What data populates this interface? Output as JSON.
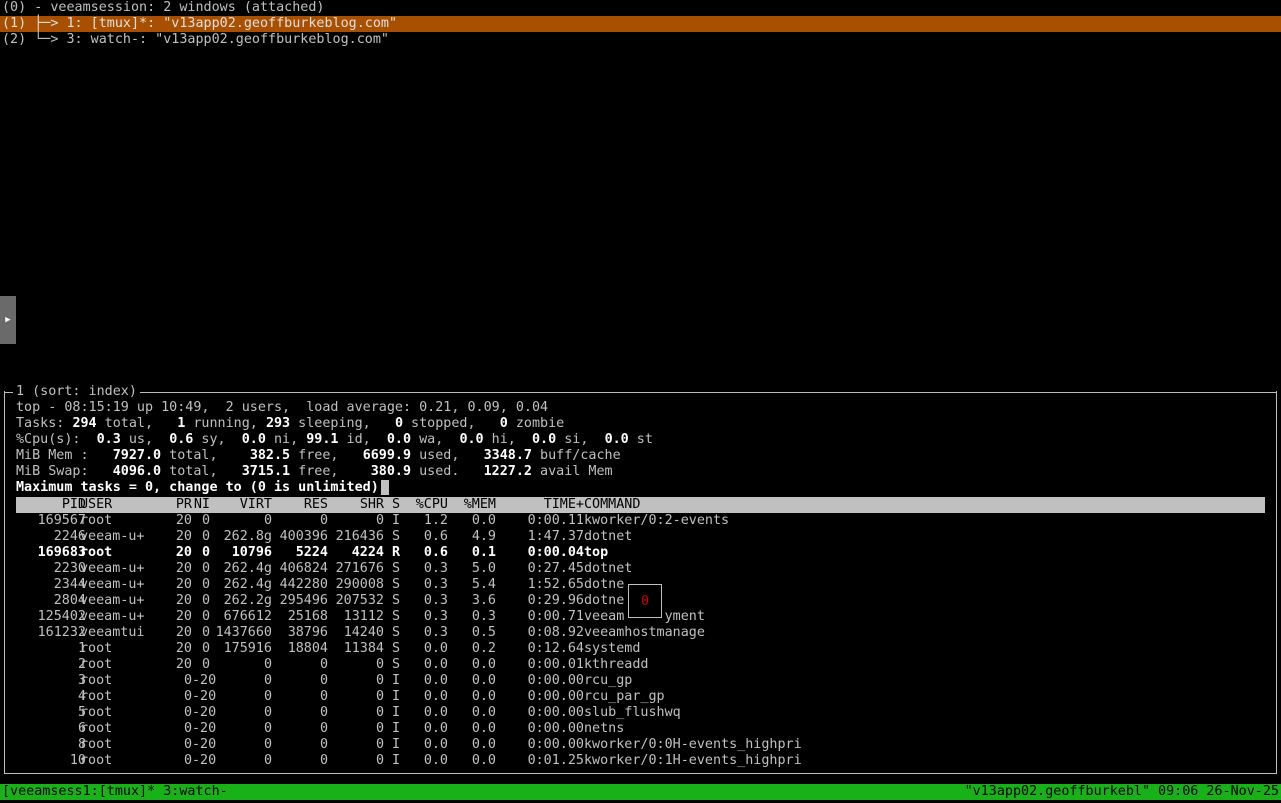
{
  "tree": {
    "header": "(0) - veeamsession: 2 windows (attached)",
    "rows": [
      {
        "text": "(1) ├─> 1: [tmux]*: \"v13app02.geoffburkeblog.com\"",
        "selected": true
      },
      {
        "text": "(2) └─> 3: watch-: \"v13app02.geoffburkeblog.com\"",
        "selected": false
      }
    ]
  },
  "side_handle_icon": "right-triangle-icon",
  "pane": {
    "title": "1 (sort: index)",
    "summary": {
      "line1": "top - 08:15:19 up 10:49,  2 users,  load average: 0.21, 0.09, 0.04",
      "tasks": {
        "label": "Tasks:",
        "total": "294",
        "total_l": " total,   ",
        "running": "1",
        "running_l": " running, ",
        "sleeping": "293",
        "sleeping_l": " sleeping,   ",
        "stopped": "0",
        "stopped_l": " stopped,   ",
        "zombie": "0",
        "zombie_l": " zombie"
      },
      "cpu": {
        "label": "%Cpu(s):  ",
        "us": "0.3",
        "us_l": " us,  ",
        "sy": "0.6",
        "sy_l": " sy,  ",
        "ni": "0.0",
        "ni_l": " ni, ",
        "id": "99.1",
        "id_l": " id,  ",
        "wa": "0.0",
        "wa_l": " wa,  ",
        "hi": "0.0",
        "hi_l": " hi,  ",
        "si": "0.0",
        "si_l": " si,  ",
        "st": "0.0",
        "st_l": " st"
      },
      "mem": {
        "label": "MiB Mem :   ",
        "total": "7927.0",
        "total_l": " total,    ",
        "free": "382.5",
        "free_l": " free,   ",
        "used": "6699.9",
        "used_l": " used,   ",
        "buff": "3348.7",
        "buff_l": " buff/cache"
      },
      "swap": {
        "label": "MiB Swap:   ",
        "total": "4096.0",
        "total_l": " total,   ",
        "free": "3715.1",
        "free_l": " free,    ",
        "used": "380.9",
        "used_l": " used.   ",
        "avail": "1227.2",
        "avail_l": " avail Mem"
      },
      "prompt": "Maximum tasks = 0, change to (0 is unlimited)"
    },
    "columns": {
      "pid": "PID",
      "user": "USER",
      "pr": "PR",
      "ni": "NI",
      "virt": "VIRT",
      "res": "RES",
      "shr": "SHR",
      "s": "S",
      "cpu": "%CPU",
      "mem": "%MEM",
      "time": "TIME+",
      "cmd": "COMMAND"
    },
    "processes": [
      {
        "pid": "169567",
        "user": "root",
        "pr": "20",
        "ni": "0",
        "virt": "0",
        "res": "0",
        "shr": "0",
        "s": "I",
        "cpu": "1.2",
        "mem": "0.0",
        "time": "0:00.11",
        "cmd": "kworker/0:2-events"
      },
      {
        "pid": "2246",
        "user": "veeam-u+",
        "pr": "20",
        "ni": "0",
        "virt": "262.8g",
        "res": "400396",
        "shr": "216436",
        "s": "S",
        "cpu": "0.6",
        "mem": "4.9",
        "time": "1:47.37",
        "cmd": "dotnet"
      },
      {
        "pid": "169683",
        "user": "root",
        "pr": "20",
        "ni": "0",
        "virt": "10796",
        "res": "5224",
        "shr": "4224",
        "s": "R",
        "cpu": "0.6",
        "mem": "0.1",
        "time": "0:00.04",
        "cmd": "top",
        "hl": true
      },
      {
        "pid": "2230",
        "user": "veeam-u+",
        "pr": "20",
        "ni": "0",
        "virt": "262.4g",
        "res": "406824",
        "shr": "271676",
        "s": "S",
        "cpu": "0.3",
        "mem": "5.0",
        "time": "0:27.45",
        "cmd": "dotnet"
      },
      {
        "pid": "2344",
        "user": "veeam-u+",
        "pr": "20",
        "ni": "0",
        "virt": "262.4g",
        "res": "442280",
        "shr": "290008",
        "s": "S",
        "cpu": "0.3",
        "mem": "5.4",
        "time": "1:52.65",
        "cmd": "dotne"
      },
      {
        "pid": "2804",
        "user": "veeam-u+",
        "pr": "20",
        "ni": "0",
        "virt": "262.2g",
        "res": "295496",
        "shr": "207532",
        "s": "S",
        "cpu": "0.3",
        "mem": "3.6",
        "time": "0:29.96",
        "cmd": "dotne"
      },
      {
        "pid": "125402",
        "user": "veeam-u+",
        "pr": "20",
        "ni": "0",
        "virt": "676612",
        "res": "25168",
        "shr": "13112",
        "s": "S",
        "cpu": "0.3",
        "mem": "0.3",
        "time": "0:00.71",
        "cmd": "veeam     yment"
      },
      {
        "pid": "161232",
        "user": "veeamtui",
        "pr": "20",
        "ni": "0",
        "virt": "1437660",
        "res": "38796",
        "shr": "14240",
        "s": "S",
        "cpu": "0.3",
        "mem": "0.5",
        "time": "0:08.92",
        "cmd": "veeamhostmanage"
      },
      {
        "pid": "1",
        "user": "root",
        "pr": "20",
        "ni": "0",
        "virt": "175916",
        "res": "18804",
        "shr": "11384",
        "s": "S",
        "cpu": "0.0",
        "mem": "0.2",
        "time": "0:12.64",
        "cmd": "systemd"
      },
      {
        "pid": "2",
        "user": "root",
        "pr": "20",
        "ni": "0",
        "virt": "0",
        "res": "0",
        "shr": "0",
        "s": "S",
        "cpu": "0.0",
        "mem": "0.0",
        "time": "0:00.01",
        "cmd": "kthreadd"
      },
      {
        "pid": "3",
        "user": "root",
        "pr": "0",
        "ni": "-20",
        "virt": "0",
        "res": "0",
        "shr": "0",
        "s": "I",
        "cpu": "0.0",
        "mem": "0.0",
        "time": "0:00.00",
        "cmd": "rcu_gp"
      },
      {
        "pid": "4",
        "user": "root",
        "pr": "0",
        "ni": "-20",
        "virt": "0",
        "res": "0",
        "shr": "0",
        "s": "I",
        "cpu": "0.0",
        "mem": "0.0",
        "time": "0:00.00",
        "cmd": "rcu_par_gp"
      },
      {
        "pid": "5",
        "user": "root",
        "pr": "0",
        "ni": "-20",
        "virt": "0",
        "res": "0",
        "shr": "0",
        "s": "I",
        "cpu": "0.0",
        "mem": "0.0",
        "time": "0:00.00",
        "cmd": "slub_flushwq"
      },
      {
        "pid": "6",
        "user": "root",
        "pr": "0",
        "ni": "-20",
        "virt": "0",
        "res": "0",
        "shr": "0",
        "s": "I",
        "cpu": "0.0",
        "mem": "0.0",
        "time": "0:00.00",
        "cmd": "netns"
      },
      {
        "pid": "8",
        "user": "root",
        "pr": "0",
        "ni": "-20",
        "virt": "0",
        "res": "0",
        "shr": "0",
        "s": "I",
        "cpu": "0.0",
        "mem": "0.0",
        "time": "0:00.00",
        "cmd": "kworker/0:0H-events_highpri"
      },
      {
        "pid": "10",
        "user": "root",
        "pr": "0",
        "ni": "-20",
        "virt": "0",
        "res": "0",
        "shr": "0",
        "s": "I",
        "cpu": "0.0",
        "mem": "0.0",
        "time": "0:01.25",
        "cmd": "kworker/0:1H-events_highpri"
      }
    ],
    "badge": "0"
  },
  "status": {
    "left": "[veeamsess1:[tmux]* 3:watch-",
    "right": "\"v13app02.geoffburkebl\" 09:06 26-Nov-25"
  },
  "colors": {
    "selection": "#a84f00",
    "status_bar": "#18b218",
    "badge_text": "#d00000",
    "header_bg": "#c0c0c0"
  }
}
